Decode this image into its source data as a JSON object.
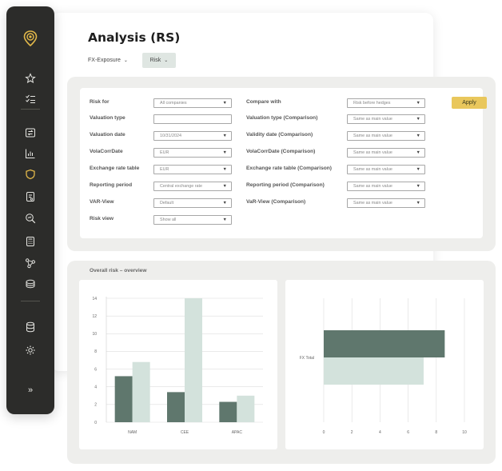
{
  "header": {
    "title": "Analysis (RS)",
    "tabs": [
      {
        "label": "FX-Exposure",
        "active": false
      },
      {
        "label": "Risk",
        "active": true
      }
    ]
  },
  "sidebar": {
    "icons": [
      "pin-logo-icon",
      "star-icon",
      "checklist-icon",
      "exchange-icon",
      "bar-chart-icon",
      "shield-icon",
      "document-icon",
      "search-chart-icon",
      "calculator-icon",
      "network-icon",
      "coins-icon",
      "database-icon",
      "settings-icon",
      "expand-icon"
    ],
    "active": "shield-icon",
    "accent": "#e2b84a",
    "expand_label": "»"
  },
  "filters": {
    "left": [
      {
        "label": "Risk for",
        "value": "All companies",
        "type": "select"
      },
      {
        "label": "Valuation type",
        "value": "",
        "type": "input"
      },
      {
        "label": "Valuation date",
        "value": "10/31/2024",
        "type": "select"
      },
      {
        "label": "VolaCorrDate",
        "value": "EUR",
        "type": "select"
      },
      {
        "label": "Exchange rate table",
        "value": "EUR",
        "type": "select"
      },
      {
        "label": "Reporting period",
        "value": "Central exchange rate",
        "type": "select"
      },
      {
        "label": "VAR-View",
        "value": "Default",
        "type": "select"
      },
      {
        "label": "Risk view",
        "value": "Show all",
        "type": "select"
      }
    ],
    "right": [
      {
        "label": "Compare with",
        "value": "Risk before hedges"
      },
      {
        "label": "Valuation type (Comparison)",
        "value": "Same as main value"
      },
      {
        "label": "Validity date (Comparison)",
        "value": "Same as main value"
      },
      {
        "label": "VolaCorrDate (Comparison)",
        "value": "Same as main value"
      },
      {
        "label": "Exchange rate table (Comparison)",
        "value": "Same as main value"
      },
      {
        "label": "Reporting period (Comparison)",
        "value": "Same as main value"
      },
      {
        "label": "VaR-View (Comparison)",
        "value": "Same as main value"
      }
    ],
    "apply_label": "Apply",
    "arrow": "▼"
  },
  "overview": {
    "title": "Overall risk – overview"
  },
  "colors": {
    "dark_series": "#5f776d",
    "light_series": "#d3e2dc",
    "apply": "#e9c75c",
    "sidebar_bg": "#2c2c2a"
  },
  "chart_data": [
    {
      "type": "bar",
      "categories": [
        "NAM",
        "CEE",
        "APAC"
      ],
      "series": [
        {
          "values": [
            5.2,
            3.4,
            2.3
          ],
          "color": "#5f776d"
        },
        {
          "values": [
            6.8,
            14.0,
            3.0
          ],
          "color": "#d3e2dc"
        }
      ],
      "ylim": [
        0,
        14
      ],
      "yticks": [
        0,
        2,
        4,
        6,
        8,
        10,
        12,
        14
      ],
      "grid": true
    },
    {
      "type": "bar",
      "orientation": "horizontal",
      "categories": [
        "FX Total"
      ],
      "series": [
        {
          "values": [
            8.6
          ],
          "color": "#5f776d"
        },
        {
          "values": [
            7.1
          ],
          "color": "#d3e2dc"
        }
      ],
      "xlim": [
        0,
        10
      ],
      "xticks": [
        0,
        2,
        4,
        6,
        8,
        10
      ],
      "grid": true
    }
  ]
}
